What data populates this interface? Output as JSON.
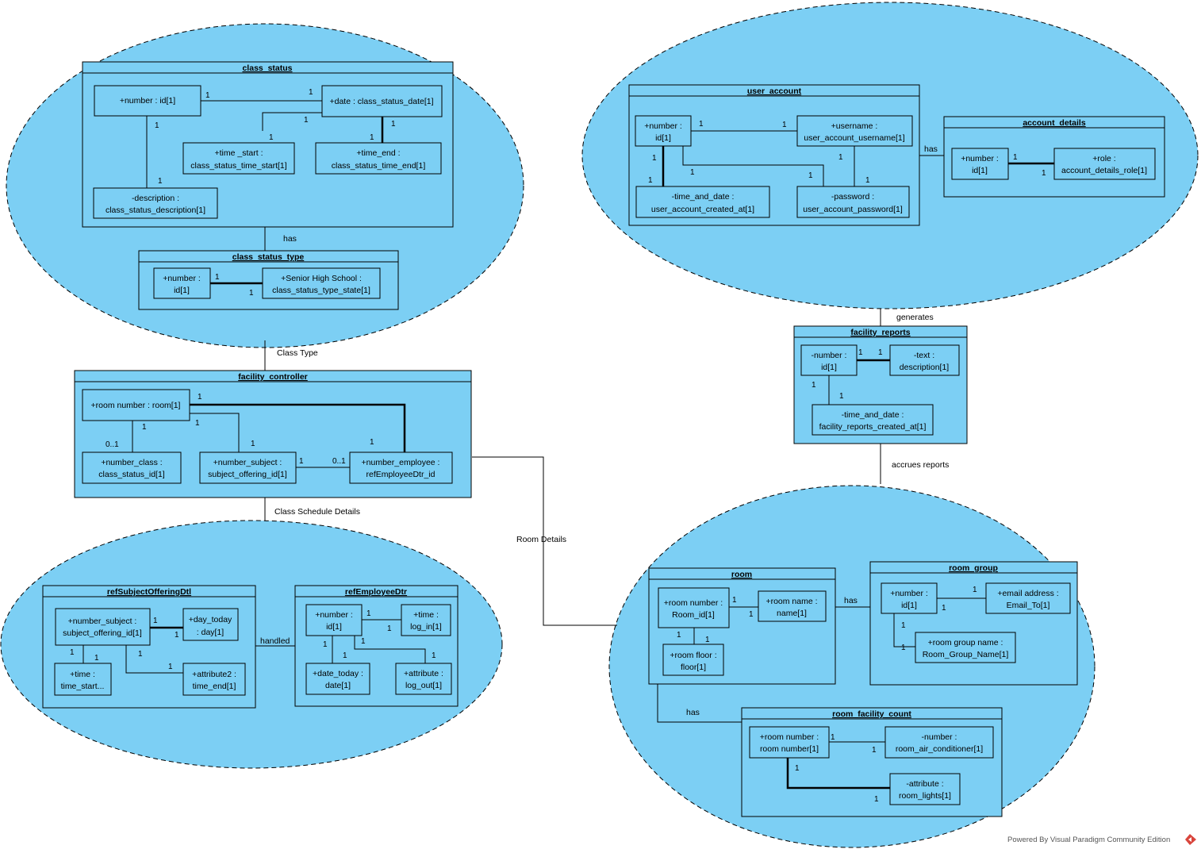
{
  "footer": "Powered By Visual Paradigm Community Edition",
  "relations": {
    "cs_has": "has",
    "class_type": "Class Type",
    "class_schedule_details": "Class Schedule Details",
    "room_details": "Room Details",
    "handled": "handled",
    "ua_has": "has",
    "generates": "generates",
    "accrues_reports": "accrues reports",
    "room_has": "has",
    "room_has2": "has"
  },
  "frames": {
    "class_status": "class_status",
    "class_status_type": "class_status_type",
    "facility_controller": "facility_controller",
    "refSubjectOfferingDtl": "refSubjectOfferingDtl",
    "refEmployeeDtr": "refEmployeeDtr",
    "user_account": "user_account",
    "account_details": "account_details",
    "facility_reports": "facility_reports",
    "room": "room",
    "room_group": "room_group",
    "room_facility_count": "room_facility_count"
  },
  "attrs": {
    "cs_number": [
      "+number : id[1]"
    ],
    "cs_date": [
      "+date : class_status_date[1]"
    ],
    "cs_time_start": [
      "+time _start :",
      "class_status_time_start[1]"
    ],
    "cs_time_end": [
      "+time_end :",
      "class_status_time_end[1]"
    ],
    "cs_description": [
      "-description :",
      "class_status_description[1]"
    ],
    "cst_number": [
      "+number :",
      "id[1]"
    ],
    "cst_shs": [
      "+Senior High School :",
      "class_status_type_state[1]"
    ],
    "fc_room_number": [
      "+room number : room[1]"
    ],
    "fc_number_class": [
      "+number_class :",
      "class_status_id[1]"
    ],
    "fc_number_subject": [
      "+number_subject :",
      "subject_offering_id[1]"
    ],
    "fc_number_employee": [
      "+number_employee :",
      "refEmployeeDtr_id"
    ],
    "rso_number_subject": [
      "+number_subject :",
      "subject_offering_id[1]"
    ],
    "rso_day_today": [
      "+day_today",
      ": day[1]"
    ],
    "rso_time": [
      "+time :",
      "time_start..."
    ],
    "rso_attribute2": [
      "+attribute2 :",
      "time_end[1]"
    ],
    "red_number": [
      "+number :",
      "id[1]"
    ],
    "red_time": [
      "+time :",
      "log_in[1]"
    ],
    "red_date_today": [
      "+date_today :",
      "date[1]"
    ],
    "red_attribute": [
      "+attribute :",
      "log_out[1]"
    ],
    "ua_number": [
      "+number :",
      "id[1]"
    ],
    "ua_username": [
      "+username :",
      "user_account_username[1]"
    ],
    "ua_time_and_date": [
      "-time_and_date :",
      "user_account_created_at[1]"
    ],
    "ua_password": [
      "-password :",
      "user_account_password[1]"
    ],
    "ad_number": [
      "+number :",
      "id[1]"
    ],
    "ad_role": [
      "+role :",
      "account_details_role[1]"
    ],
    "fr_number": [
      "-number :",
      "id[1]"
    ],
    "fr_text": [
      "-text :",
      "description[1]"
    ],
    "fr_time_and_date": [
      "-time_and_date :",
      "facility_reports_created_at[1]"
    ],
    "room_number": [
      "+room number :",
      "Room_id[1]"
    ],
    "room_name": [
      "+room name :",
      "name[1]"
    ],
    "room_floor": [
      "+room floor :",
      "floor[1]"
    ],
    "rg_number": [
      "+number :",
      "id[1]"
    ],
    "rg_email": [
      "+email address :",
      "Email_To[1]"
    ],
    "rg_group_name": [
      "+room group name :",
      "Room_Group_Name[1]"
    ],
    "rfc_room_number": [
      "+room number :",
      "room number[1]"
    ],
    "rfc_number": [
      "-number :",
      "room_air_conditioner[1]"
    ],
    "rfc_attribute": [
      "-attribute :",
      "room_lights[1]"
    ]
  },
  "multiplicities": {
    "m1": "1",
    "m0_1": "0..1"
  }
}
